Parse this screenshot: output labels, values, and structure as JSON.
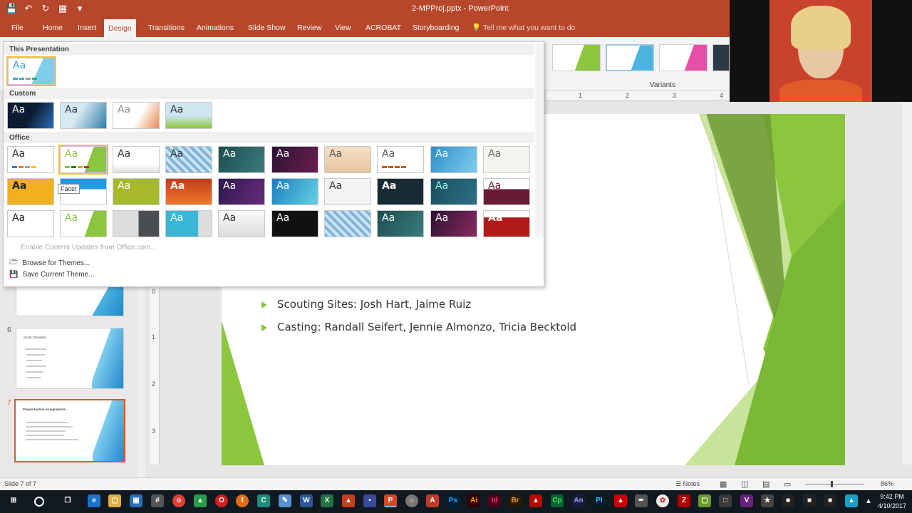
{
  "window": {
    "title": "2-MPProj.pptx - PowerPoint"
  },
  "ribbon_tabs": [
    "File",
    "Home",
    "Insert",
    "Design",
    "Transitions",
    "Animations",
    "Slide Show",
    "Review",
    "View",
    "ACROBAT",
    "Storyboarding"
  ],
  "active_tab": "Design",
  "tell_me": "Tell me what you want to do",
  "variants": {
    "label": "Variants"
  },
  "ruler_ticks": [
    "1",
    "2",
    "3",
    "4"
  ],
  "vruler_ticks": [
    "0",
    "1",
    "2",
    "3"
  ],
  "gallery": {
    "sections": [
      "This Presentation",
      "Custom",
      "Office"
    ],
    "tooltip": "Facet",
    "menu": {
      "enable_updates": "Enable Content Updates from Office.com...",
      "browse": "Browse for Themes...",
      "save": "Save Current Theme..."
    },
    "tile_label": "Aa"
  },
  "thumbnails": [
    {
      "num": "",
      "title": ""
    },
    {
      "num": "6",
      "title": "Script Schedule"
    },
    {
      "num": "7",
      "title": "Preproduction Assignments"
    }
  ],
  "slide": {
    "bullets": [
      "Scouting Sites: Josh Hart, Jaime Ruiz",
      "Casting: Randall Seifert, Jennie Almonzo, Tricia Becktold"
    ]
  },
  "status": {
    "slide_info": "Slide 7 of 7",
    "notes": "Notes",
    "zoom": "86%"
  },
  "clock": {
    "time": "9:42 PM",
    "date": "4/10/2017"
  },
  "colors": {
    "accent": "#b7472a",
    "facet_green": "#8cc63e"
  }
}
